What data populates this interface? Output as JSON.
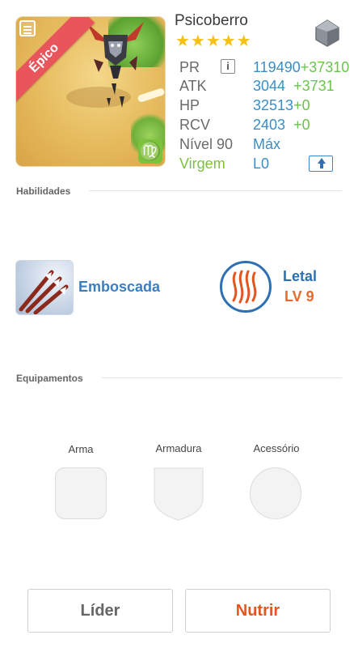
{
  "character": {
    "name": "Psicoberro",
    "rarity": "Épico",
    "stars": "★★★★★",
    "star_count": 5,
    "zodiac_symbol": "♍",
    "zodiac_sign": "Virgem",
    "portrait_icon": "monster-portrait",
    "element_icon": "gray-gem-icon"
  },
  "stats": [
    {
      "label": "PR",
      "value": "119490",
      "bonus": "+37310"
    },
    {
      "label": "ATK",
      "value": "3044",
      "bonus": "+3731"
    },
    {
      "label": "HP",
      "value": "32513",
      "bonus": "+0"
    },
    {
      "label": "RCV",
      "value": "2403",
      "bonus": "+0"
    },
    {
      "label": "Nível 90",
      "value": "Máx",
      "bonus": ""
    },
    {
      "label": "Virgem",
      "value": "L0",
      "bonus": ""
    }
  ],
  "sections": {
    "skills_title": "Habilidades",
    "equipment_title": "Equipamentos"
  },
  "skills": {
    "active": {
      "name": "Emboscada",
      "icon": "arrows-icon"
    },
    "passive": {
      "name": "Letal",
      "level": "LV 9",
      "icon": "claw-marks-icon"
    }
  },
  "equipment": [
    {
      "label": "Arma",
      "icon": "weapon-slot-icon"
    },
    {
      "label": "Armadura",
      "icon": "armor-slot-icon"
    },
    {
      "label": "Acessório",
      "icon": "accessory-slot-icon"
    }
  ],
  "buttons": {
    "leader": "Líder",
    "feed": "Nutrir"
  },
  "colors": {
    "rarity_ribbon": "#e8555a",
    "value_blue": "#3a8ec6",
    "bonus_green": "#6bc44c",
    "zodiac_green": "#7cc23b",
    "feed_orange": "#e2561f",
    "star_gold": "#f5c213"
  }
}
